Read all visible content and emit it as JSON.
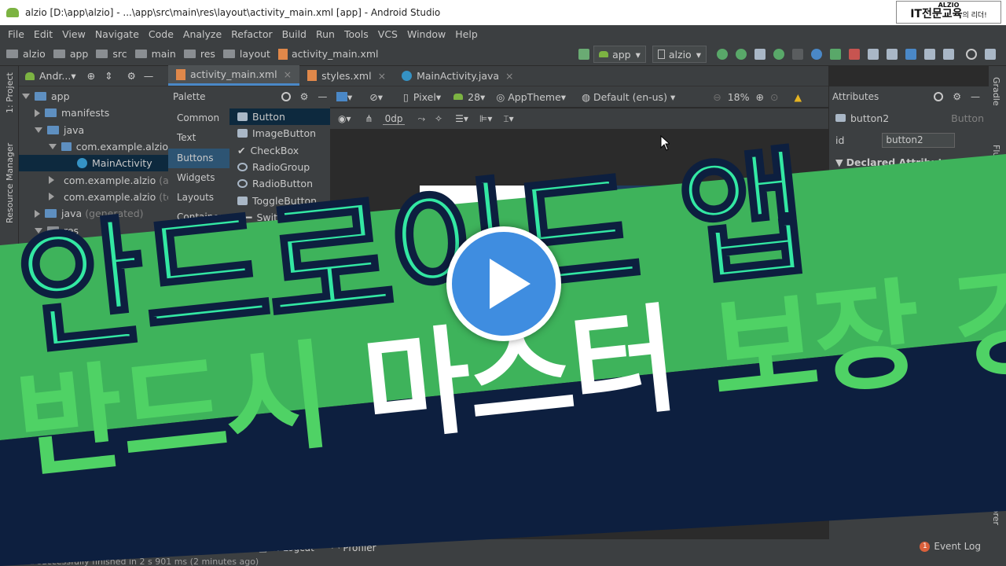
{
  "window": {
    "title": "alzio [D:\\app\\alzio] - ...\\app\\src\\main\\res\\layout\\activity_main.xml [app] - Android Studio"
  },
  "brand": {
    "small": "ALZIO",
    "big": "IT전문교육",
    "suffix": "의 리더!"
  },
  "menu": [
    "File",
    "Edit",
    "View",
    "Navigate",
    "Code",
    "Analyze",
    "Refactor",
    "Build",
    "Run",
    "Tools",
    "VCS",
    "Window",
    "Help"
  ],
  "breadcrumbs": [
    "alzio",
    "app",
    "src",
    "main",
    "res",
    "layout",
    "activity_main.xml"
  ],
  "run_config": {
    "module": "app",
    "device": "alzio"
  },
  "project": {
    "view": "Andr...",
    "tree": [
      {
        "label": "app",
        "depth": 0,
        "open": true,
        "icon": "folder"
      },
      {
        "label": "manifests",
        "depth": 1,
        "open": false,
        "icon": "folder"
      },
      {
        "label": "java",
        "depth": 1,
        "open": true,
        "icon": "folder"
      },
      {
        "label": "com.example.alzio",
        "depth": 2,
        "open": true,
        "icon": "folder"
      },
      {
        "label": "MainActivity",
        "depth": 3,
        "icon": "class",
        "selected": true
      },
      {
        "label": "com.example.alzio",
        "suffix": "(a",
        "depth": 2,
        "open": false,
        "icon": "folder"
      },
      {
        "label": "com.example.alzio",
        "suffix": "(te",
        "depth": 2,
        "open": false,
        "icon": "folder"
      },
      {
        "label": "java",
        "suffix": "(generated)",
        "depth": 1,
        "open": false,
        "icon": "folder"
      },
      {
        "label": "res",
        "depth": 1,
        "open": true,
        "icon": "folder"
      }
    ]
  },
  "tabs": [
    {
      "label": "activity_main.xml",
      "active": true
    },
    {
      "label": "styles.xml",
      "active": false
    },
    {
      "label": "MainActivity.java",
      "active": false
    }
  ],
  "palette": {
    "title": "Palette",
    "categories": [
      "Common",
      "Text",
      "Buttons",
      "Widgets",
      "Layouts",
      "Containers"
    ],
    "active_category": "Buttons",
    "items": [
      "Button",
      "ImageButton",
      "CheckBox",
      "RadioGroup",
      "RadioButton",
      "ToggleButton",
      "Switch"
    ]
  },
  "design_toolbar": {
    "device": "Pixel",
    "api": "28",
    "theme": "AppTheme",
    "locale": "Default (en-us)",
    "zoom": "18%",
    "margin": "0dp"
  },
  "attributes": {
    "title": "Attributes",
    "component": "button2",
    "component_type": "Button",
    "id_label": "id",
    "id_value": "button2",
    "section": "Declared Attributes"
  },
  "left_strip": [
    "1: Project",
    "Resource Manager"
  ],
  "right_strip": [
    "Gradle",
    "Flu",
    "ce File Explorer"
  ],
  "bottom_tools": [
    "Build",
    "6: Logcat",
    "Profiler"
  ],
  "event_log": {
    "count": "1",
    "label": "Event Log"
  },
  "status": "...ild successfully finished in 2 s 901 ms (2 minutes ago)",
  "overlay": {
    "line1": "안드로이드 앱",
    "line2_a": "반드시 ",
    "line2_b": "마스터",
    "line2_c": " 보장 강의"
  },
  "colors": {
    "headline1": "#33e8a3",
    "headline2": "#4fd265",
    "band": "#0d1f3f",
    "play": "#3f8de0"
  }
}
